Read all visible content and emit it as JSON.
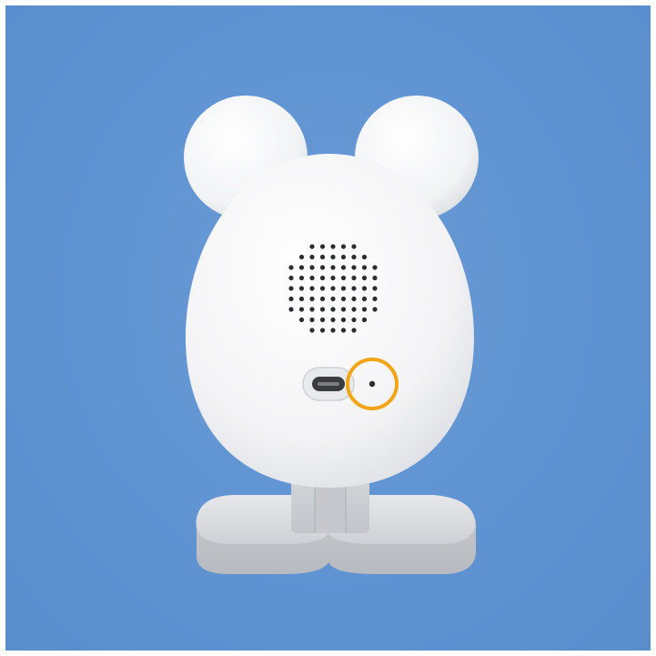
{
  "scene": {
    "subject": "camera-back-view",
    "colors": {
      "background": "#6096d3",
      "device_body": "#f7f7f8",
      "stand": "#d9dade",
      "highlight_ring": "#f2a516",
      "port": "#3a3c40",
      "speaker_holes": "#2b2d31"
    },
    "highlight": {
      "target": "reset-pinhole",
      "shape": "circle"
    }
  }
}
